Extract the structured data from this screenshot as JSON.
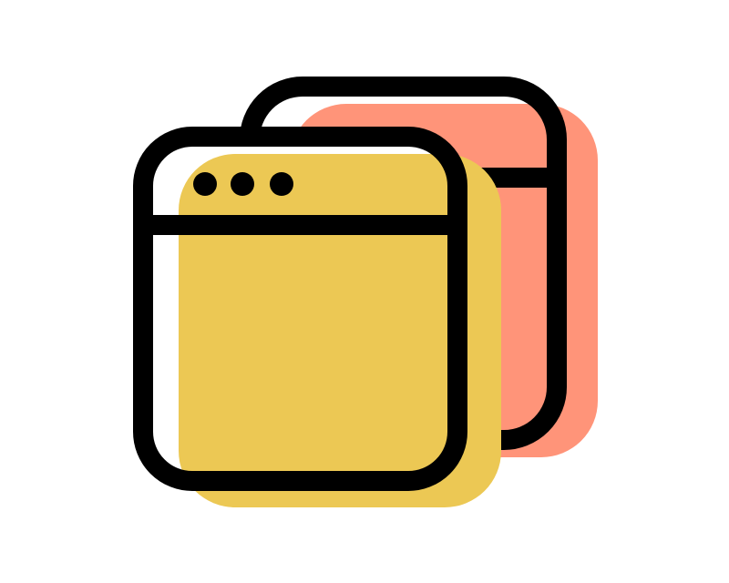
{
  "icon": {
    "name": "browser-windows-icon",
    "colors": {
      "background": "#ffffff",
      "outline": "#000000",
      "back_window_fill": "#ff9479",
      "front_window_fill": "#ecc854",
      "window_body": "#ffffff"
    }
  }
}
